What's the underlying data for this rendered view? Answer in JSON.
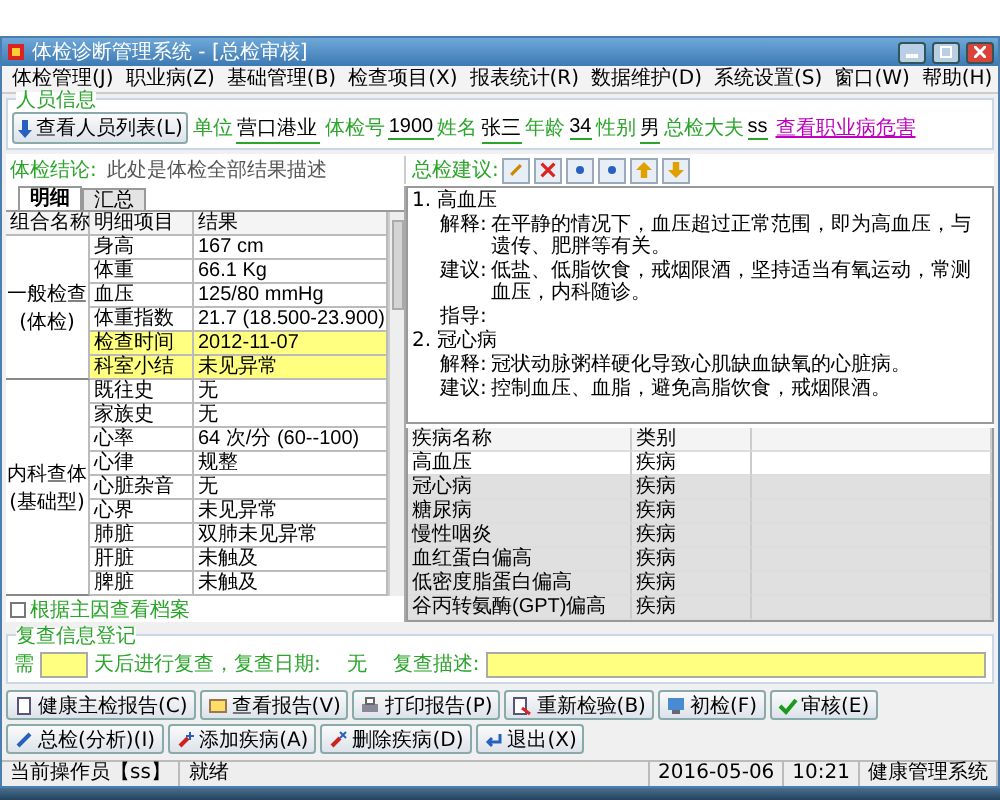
{
  "window": {
    "title": "体检诊断管理系统 - [总检审核]"
  },
  "menu": [
    "体检管理(J)",
    "职业病(Z)",
    "基础管理(B)",
    "检查项目(X)",
    "报表统计(R)",
    "数据维护(D)",
    "系统设置(S)",
    "窗口(W)",
    "帮助(H)"
  ],
  "person": {
    "group_title": "人员信息",
    "list_button": "查看人员列表(L)",
    "fields": [
      {
        "label": "单位",
        "value": "营口港业"
      },
      {
        "label": "体检号",
        "value": "1900"
      },
      {
        "label": "姓名",
        "value": "张三"
      },
      {
        "label": "年龄",
        "value": "34"
      },
      {
        "label": "性别",
        "value": "男"
      },
      {
        "label": "总检大夫",
        "value": "ss"
      }
    ],
    "link": "查看职业病危害"
  },
  "conclusion": {
    "label": "体检结论:",
    "placeholder": "此处是体检全部结果描述"
  },
  "advice_label": "总检建议:",
  "tabs": [
    {
      "label": "明细",
      "selected": true
    },
    {
      "label": "汇总",
      "selected": false
    }
  ],
  "table": {
    "columns": [
      "组合名称",
      "明细项目",
      "结果"
    ],
    "groups": [
      {
        "name_lines": [
          "一般检查",
          "(体检)"
        ],
        "rows": [
          {
            "item": "身高",
            "result": "167  cm",
            "highlighted": false
          },
          {
            "item": "体重",
            "result": "66.1  Kg",
            "highlighted": false
          },
          {
            "item": "血压",
            "result": "125/80  mmHg",
            "highlighted": false
          },
          {
            "item": "体重指数",
            "result": "21.7  (18.500-23.900)",
            "highlighted": false
          },
          {
            "item": "检查时间",
            "result": "2012-11-07",
            "highlighted": true
          },
          {
            "item": "科室小结",
            "result": "未见异常",
            "highlighted": true
          }
        ]
      },
      {
        "name_lines": [
          "内科查体",
          "(基础型)"
        ],
        "rows": [
          {
            "item": "既往史",
            "result": "无",
            "highlighted": false
          },
          {
            "item": "家族史",
            "result": "无",
            "highlighted": false
          },
          {
            "item": "心率",
            "result": "64  次/分  (60--100)",
            "highlighted": false
          },
          {
            "item": "心律",
            "result": "规整",
            "highlighted": false
          },
          {
            "item": "心脏杂音",
            "result": "无",
            "highlighted": false
          },
          {
            "item": "心界",
            "result": "未见异常",
            "highlighted": false
          },
          {
            "item": "肺脏",
            "result": "双肺未见异常",
            "highlighted": false
          },
          {
            "item": "肝脏",
            "result": "未触及",
            "highlighted": false
          },
          {
            "item": "脾脏",
            "result": "未触及",
            "highlighted": false
          }
        ]
      }
    ]
  },
  "main_cause_checkbox": {
    "label": "根据主因查看档案",
    "checked": false
  },
  "advice": [
    {
      "number": "1.",
      "title": "高血压",
      "sections": [
        {
          "label": "解释:",
          "text": "在平静的情况下，血压超过正常范围，即为高血压，与遗传、肥胖等有关。"
        },
        {
          "label": "建议:",
          "text": "低盐、低脂饮食，戒烟限酒，坚持适当有氧运动，常测血压，内科随诊。"
        },
        {
          "label": "指导:"
        }
      ]
    },
    {
      "number": "2.",
      "title": "冠心病",
      "sections": [
        {
          "label": "解释:",
          "text": "冠状动脉粥样硬化导致心肌缺血缺氧的心脏病。"
        },
        {
          "label": "建议:",
          "text": "控制血压、血脂，避免高脂饮食，戒烟限酒。"
        }
      ]
    }
  ],
  "diseases": {
    "columns": [
      "疾病名称",
      "类别"
    ],
    "rows": [
      {
        "name": "高血压",
        "category": "疾病",
        "selected": true
      },
      {
        "name": "冠心病",
        "category": "疾病",
        "selected": false
      },
      {
        "name": "糖尿病",
        "category": "疾病",
        "selected": false
      },
      {
        "name": "慢性咽炎",
        "category": "疾病",
        "selected": false
      },
      {
        "name": "血红蛋白偏高",
        "category": "疾病",
        "selected": false
      },
      {
        "name": "低密度脂蛋白偏高",
        "category": "疾病",
        "selected": false
      },
      {
        "name": "谷丙转氨酶(GPT)偏高",
        "category": "疾病",
        "selected": false
      }
    ]
  },
  "recheck": {
    "title": "复查信息登记",
    "prefix": "需",
    "middle": "天后进行复查，复查日期:",
    "date": "无",
    "desc_label": "复查描述:"
  },
  "buttons": [
    {
      "label": "健康主检报告(C)",
      "kind": "doc"
    },
    {
      "label": "查看报告(V)",
      "kind": "image"
    },
    {
      "label": "打印报告(P)",
      "kind": "print"
    },
    {
      "label": "重新检验(B)",
      "kind": "redo"
    },
    {
      "label": "初检(F)",
      "kind": "gear"
    },
    {
      "label": "审核(E)",
      "kind": "check"
    },
    {
      "label": "总检(分析)(I)",
      "kind": "pen"
    },
    {
      "label": "添加疾病(A)",
      "kind": "add"
    },
    {
      "label": "删除疾病(D)",
      "kind": "del"
    },
    {
      "label": "退出(X)",
      "kind": "exit"
    }
  ],
  "status": {
    "operator": "当前操作员【ss】",
    "state": "就绪",
    "date": "2016-05-06",
    "time": "10:21",
    "app": "健康管理系统"
  }
}
